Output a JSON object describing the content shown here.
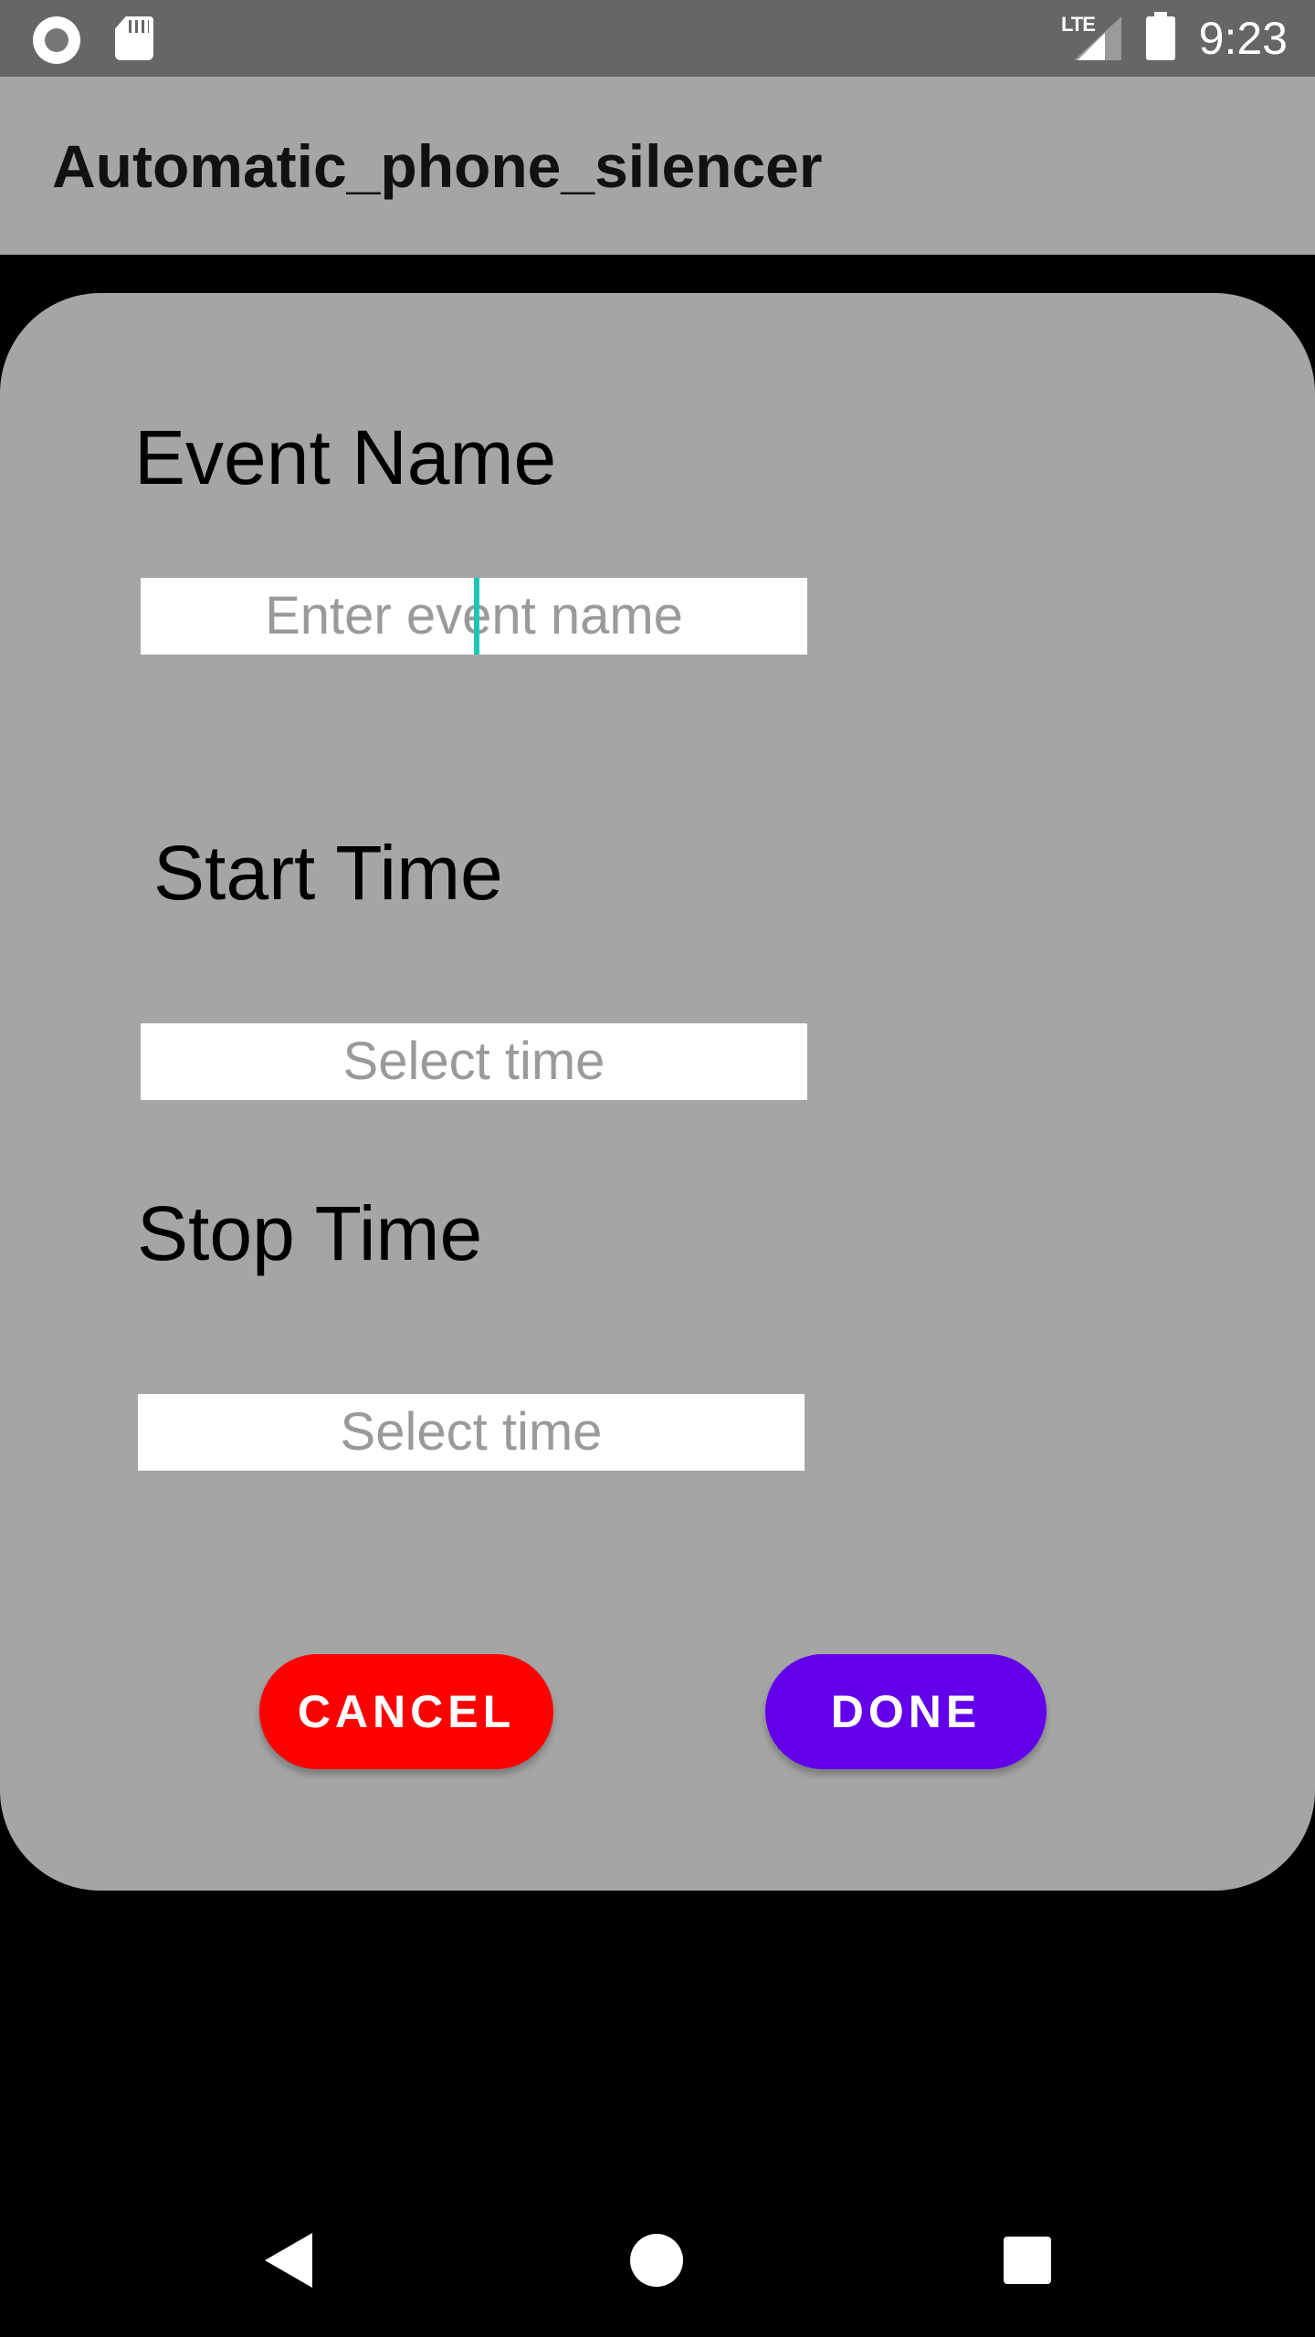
{
  "status_bar": {
    "network_label": "LTE",
    "time": "9:23",
    "icons": [
      "radio-icon",
      "sd-card-icon",
      "signal-icon",
      "battery-icon"
    ]
  },
  "app_bar": {
    "title": "Automatic_phone_silencer"
  },
  "dialog": {
    "event_name_label": "Event Name",
    "event_name_placeholder": "Enter event name",
    "start_time_label": "Start Time",
    "start_time_placeholder": "Select time",
    "stop_time_label": "Stop Time",
    "stop_time_placeholder": "Select time",
    "cancel_label": "CANCEL",
    "done_label": "DONE"
  },
  "colors": {
    "status_bar": "#666666",
    "surface": "#a5a5a5",
    "cancel": "#ff0000",
    "done": "#6200ea",
    "caret": "#1bc6b6"
  },
  "nav_bar": {
    "icons": [
      "back-icon",
      "home-icon",
      "recent-apps-icon"
    ]
  }
}
